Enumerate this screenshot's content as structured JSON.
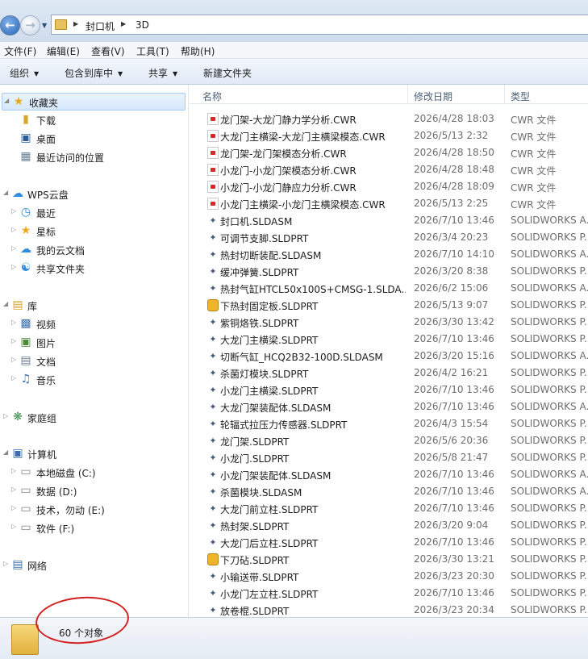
{
  "address": {
    "path": [
      "封口机",
      "3D"
    ]
  },
  "menu": [
    "文件(F)",
    "编辑(E)",
    "查看(V)",
    "工具(T)",
    "帮助(H)"
  ],
  "toolbar": {
    "organize": "组织",
    "include_library": "包含到库中",
    "share": "共享",
    "new_folder": "新建文件夹"
  },
  "nav": {
    "favorites": "收藏夹",
    "downloads": "下载",
    "desktop": "桌面",
    "recent": "最近访问的位置",
    "wps": "WPS云盘",
    "wps_recent": "最近",
    "wps_star": "星标",
    "wps_cloud": "我的云文档",
    "wps_shared": "共享文件夹",
    "libraries": "库",
    "videos": "视频",
    "pictures": "图片",
    "documents": "文档",
    "music": "音乐",
    "homegroup": "家庭组",
    "computer": "计算机",
    "drive_c": "本地磁盘 (C:)",
    "drive_d": "数据 (D:)",
    "drive_e": "技术，勿动 (E:)",
    "drive_f": "软件 (F:)",
    "network": "网络"
  },
  "columns": {
    "name": "名称",
    "date": "修改日期",
    "type": "类型"
  },
  "files": [
    {
      "name": "龙门架-大龙门静力学分析.CWR",
      "date": "2026/4/28 18:03",
      "type": "CWR 文件",
      "icon": "cwr"
    },
    {
      "name": "大龙门主横梁-大龙门主横梁模态.CWR",
      "date": "2026/5/13 2:32",
      "type": "CWR 文件",
      "icon": "cwr"
    },
    {
      "name": "龙门架-龙门架模态分析.CWR",
      "date": "2026/4/28 18:50",
      "type": "CWR 文件",
      "icon": "cwr"
    },
    {
      "name": "小龙门-小龙门架模态分析.CWR",
      "date": "2026/4/28 18:48",
      "type": "CWR 文件",
      "icon": "cwr"
    },
    {
      "name": "小龙门-小龙门静应力分析.CWR",
      "date": "2026/4/28 18:09",
      "type": "CWR 文件",
      "icon": "cwr"
    },
    {
      "name": "小龙门主横梁-小龙门主横梁模态.CWR",
      "date": "2026/5/13 2:25",
      "type": "CWR 文件",
      "icon": "cwr"
    },
    {
      "name": "封口机.SLDASM",
      "date": "2026/7/10 13:46",
      "type": "SOLIDWORKS A...",
      "icon": "sw"
    },
    {
      "name": "可调节支脚.SLDPRT",
      "date": "2026/3/4 20:23",
      "type": "SOLIDWORKS P...",
      "icon": "sw"
    },
    {
      "name": "热封切断装配.SLDASM",
      "date": "2026/7/10 14:10",
      "type": "SOLIDWORKS A...",
      "icon": "sw"
    },
    {
      "name": "缓冲弹簧.SLDPRT",
      "date": "2026/3/20 8:38",
      "type": "SOLIDWORKS P...",
      "icon": "sw"
    },
    {
      "name": "热封气缸HTCL50x100S+CMSG-1.SLDA...",
      "date": "2026/6/2 15:06",
      "type": "SOLIDWORKS A...",
      "icon": "sw"
    },
    {
      "name": "下热封固定板.SLDPRT",
      "date": "2026/5/13 9:07",
      "type": "SOLIDWORKS P...",
      "icon": "gold"
    },
    {
      "name": "紫铜烙铁.SLDPRT",
      "date": "2026/3/30 13:42",
      "type": "SOLIDWORKS P...",
      "icon": "sw"
    },
    {
      "name": "大龙门主横梁.SLDPRT",
      "date": "2026/7/10 13:46",
      "type": "SOLIDWORKS P...",
      "icon": "sw"
    },
    {
      "name": "切断气缸_HCQ2B32-100D.SLDASM",
      "date": "2026/3/20 15:16",
      "type": "SOLIDWORKS A...",
      "icon": "sw"
    },
    {
      "name": "杀菌灯模块.SLDPRT",
      "date": "2026/4/2 16:21",
      "type": "SOLIDWORKS P...",
      "icon": "sw"
    },
    {
      "name": "小龙门主横梁.SLDPRT",
      "date": "2026/7/10 13:46",
      "type": "SOLIDWORKS P...",
      "icon": "sw"
    },
    {
      "name": "大龙门架装配体.SLDASM",
      "date": "2026/7/10 13:46",
      "type": "SOLIDWORKS A...",
      "icon": "sw"
    },
    {
      "name": "轮辐式拉压力传感器.SLDPRT",
      "date": "2026/4/3 15:54",
      "type": "SOLIDWORKS P...",
      "icon": "sw"
    },
    {
      "name": "龙门架.SLDPRT",
      "date": "2026/5/6 20:36",
      "type": "SOLIDWORKS P...",
      "icon": "sw"
    },
    {
      "name": "小龙门.SLDPRT",
      "date": "2026/5/8 21:47",
      "type": "SOLIDWORKS P...",
      "icon": "sw"
    },
    {
      "name": "小龙门架装配体.SLDASM",
      "date": "2026/7/10 13:46",
      "type": "SOLIDWORKS A...",
      "icon": "sw"
    },
    {
      "name": "杀菌模块.SLDASM",
      "date": "2026/7/10 13:46",
      "type": "SOLIDWORKS A...",
      "icon": "sw"
    },
    {
      "name": "大龙门前立柱.SLDPRT",
      "date": "2026/7/10 13:46",
      "type": "SOLIDWORKS P...",
      "icon": "sw"
    },
    {
      "name": "热封架.SLDPRT",
      "date": "2026/3/20 9:04",
      "type": "SOLIDWORKS P...",
      "icon": "sw"
    },
    {
      "name": "大龙门后立柱.SLDPRT",
      "date": "2026/7/10 13:46",
      "type": "SOLIDWORKS P...",
      "icon": "sw"
    },
    {
      "name": "下刀砧.SLDPRT",
      "date": "2026/3/30 13:21",
      "type": "SOLIDWORKS P...",
      "icon": "gold"
    },
    {
      "name": "小输送带.SLDPRT",
      "date": "2026/3/23 20:30",
      "type": "SOLIDWORKS P...",
      "icon": "sw"
    },
    {
      "name": "小龙门左立柱.SLDPRT",
      "date": "2026/7/10 13:46",
      "type": "SOLIDWORKS P...",
      "icon": "sw"
    },
    {
      "name": "放卷棍.SLDPRT",
      "date": "2026/3/23 20:34",
      "type": "SOLIDWORKS P...",
      "icon": "sw"
    }
  ],
  "status": {
    "count": "60 个对象"
  }
}
